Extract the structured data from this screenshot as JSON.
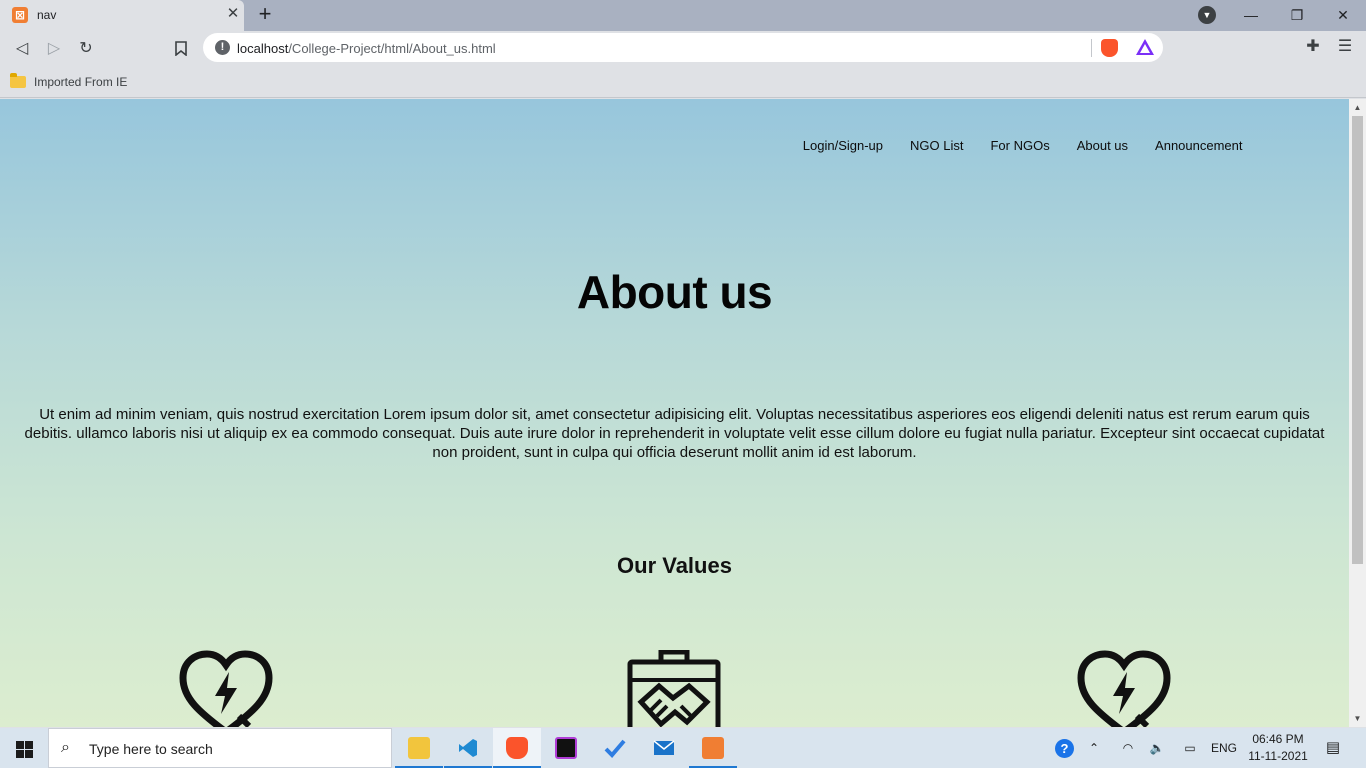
{
  "browser": {
    "tab_title": "nav",
    "tab_close": "✕",
    "new_tab": "+",
    "url_host": "localhost",
    "url_path": "/College-Project/html/About_us.html",
    "bookmark_folder": "Imported From IE"
  },
  "site": {
    "nav": [
      "Login/Sign-up",
      "NGO List",
      "For NGOs",
      "About us",
      "Announcement"
    ],
    "title": "About us",
    "about_text": "Ut enim ad minim veniam, quis nostrud exercitation Lorem ipsum dolor sit, amet consectetur adipisicing elit. Voluptas necessitatibus asperiores eos eligendi deleniti natus est rerum earum quis debitis. ullamco laboris nisi ut aliquip ex ea commodo consequat. Duis aute irure dolor in reprehenderit in voluptate velit esse cillum dolore eu fugiat nulla pariatur. Excepteur sint occaecat cupidatat non proident, sunt in culpa qui officia deserunt mollit anim id est laborum.",
    "values_title": "Our Values",
    "value_icons": [
      "heart-bolt-icon",
      "briefcase-handshake-icon",
      "heart-bolt-icon"
    ]
  },
  "taskbar": {
    "search_placeholder": "Type here to search",
    "apps": [
      "file-explorer-icon",
      "vscode-icon",
      "brave-icon",
      "intellij-icon",
      "todo-icon",
      "mail-icon",
      "xampp-icon"
    ],
    "language": "ENG",
    "time": "06:46 PM",
    "date": "11-11-2021"
  },
  "colors": {
    "gradient_top": "#97c6dc",
    "gradient_bottom": "#dcedcf",
    "chrome_bg": "#dfe1e5",
    "taskbar_bg": "#d9e4ee"
  }
}
